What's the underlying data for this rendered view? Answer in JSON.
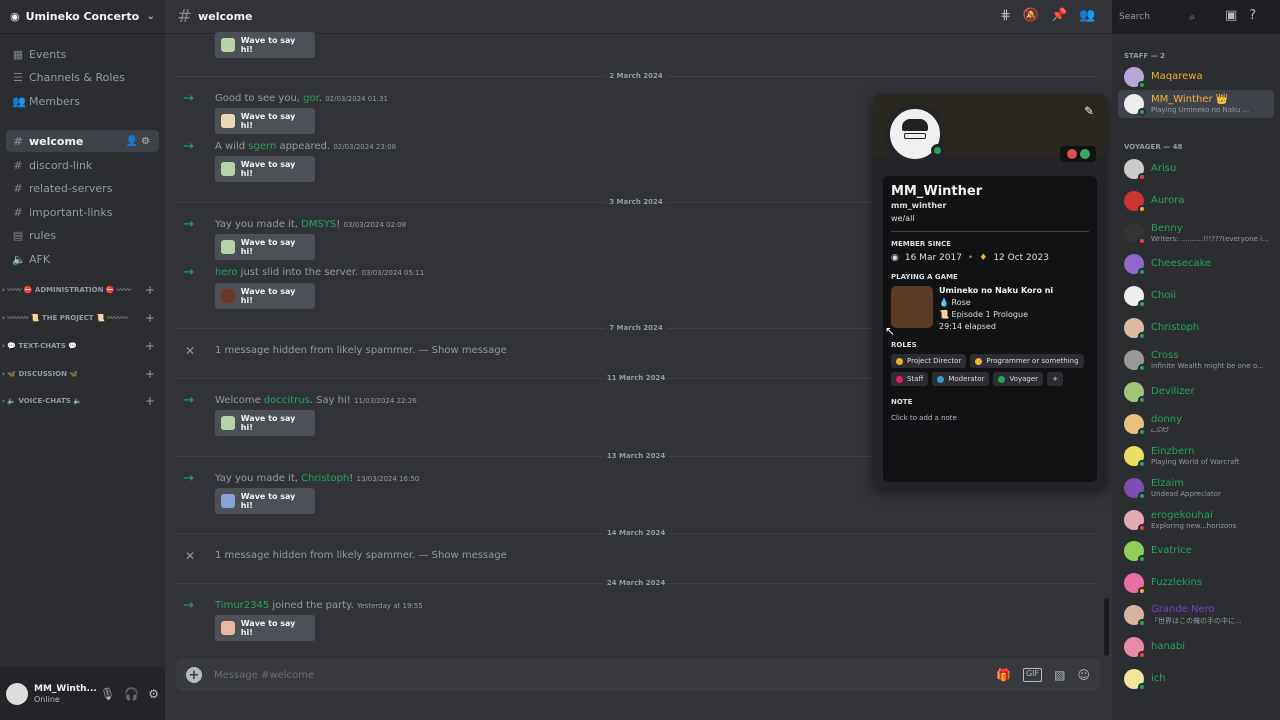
{
  "server": {
    "name": "Umineko Concerto"
  },
  "sidebar": {
    "top": [
      {
        "icon": "calendar-icon",
        "label": "Events"
      },
      {
        "icon": "list-icon",
        "label": "Channels & Roles"
      },
      {
        "icon": "members-icon",
        "label": "Members"
      }
    ],
    "channels": [
      {
        "label": "welcome",
        "icon": "#"
      },
      {
        "label": "discord-link",
        "icon": "#"
      },
      {
        "label": "related-servers",
        "icon": "#"
      },
      {
        "label": "important-links",
        "icon": "#"
      },
      {
        "label": "rules",
        "icon": "rules-icon"
      },
      {
        "label": "AFK",
        "icon": "speaker-icon"
      }
    ],
    "categories": [
      "〰〰 ⛔ ADMINISTRATION ⛔ 〰〰",
      "〰〰〰 📜 THE PROJECT 📜 〰〰〰",
      "💬 TEXT-CHATS 💬",
      "🦋 DISCUSSION 🦋",
      "🔈 VOICE-CHATS 🔈"
    ]
  },
  "user": {
    "name": "MM_Winth...",
    "status": "Online"
  },
  "channel": {
    "name": "welcome",
    "composer_placeholder": "Message #welcome"
  },
  "search": {
    "placeholder": "Search"
  },
  "messages": [
    {
      "kind": "wave",
      "wave": "Wave to say hi!"
    },
    {
      "kind": "date",
      "text": "2 March 2024"
    },
    {
      "kind": "join",
      "pre": "Good to see you, ",
      "who": "gor",
      "post": ".",
      "ts": "02/03/2024 01:31",
      "wave": "Wave to say hi!"
    },
    {
      "kind": "join",
      "pre": "A wild ",
      "who": "sgern",
      "post": " appeared.",
      "ts": "02/03/2024 23:08",
      "wave": "Wave to say hi!"
    },
    {
      "kind": "date",
      "text": "3 March 2024"
    },
    {
      "kind": "join",
      "pre": "Yay you made it, ",
      "who": "DMSYS",
      "post": "!",
      "ts": "03/03/2024 02:08",
      "wave": "Wave to say hi!"
    },
    {
      "kind": "join",
      "pre": "",
      "who": "hero",
      "post": " just slid into the server.",
      "ts": "03/03/2024 05:11",
      "wave": "Wave to say hi!"
    },
    {
      "kind": "date",
      "text": "7 March 2024"
    },
    {
      "kind": "hidden",
      "text": "1 message hidden from likely spammer. — ",
      "link": "Show message"
    },
    {
      "kind": "date",
      "text": "11 March 2024"
    },
    {
      "kind": "join",
      "pre": "Welcome ",
      "who": "doccitrus",
      "post": ". Say hi!",
      "ts": "11/03/2024 22:26",
      "wave": "Wave to say hi!"
    },
    {
      "kind": "date",
      "text": "13 March 2024"
    },
    {
      "kind": "join",
      "pre": "Yay you made it, ",
      "who": "Christoph",
      "post": "!",
      "ts": "13/03/2024 16:50",
      "wave": "Wave to say hi!"
    },
    {
      "kind": "date",
      "text": "14 March 2024"
    },
    {
      "kind": "hidden",
      "text": "1 message hidden from likely spammer. — ",
      "link": "Show message"
    },
    {
      "kind": "date",
      "text": "24 March 2024"
    },
    {
      "kind": "join",
      "pre": "",
      "who": "Timur2345",
      "post": " joined the party.",
      "ts": "Yesterday at 19:55",
      "wave": "Wave to say hi!"
    }
  ],
  "profile": {
    "name": "MM_Winther",
    "username": "mm_winther",
    "status": "we/all",
    "member_since_label": "MEMBER SINCE",
    "discord_date": "16 Mar 2017",
    "server_date": "12 Oct 2023",
    "game_label": "PLAYING A GAME",
    "game_title": "Umineko no Naku Koro ni",
    "game_char": "Rose",
    "game_episode": "Episode 1 Prologue",
    "game_elapsed": "29:14 elapsed",
    "roles_label": "ROLES",
    "roles": [
      {
        "name": "Project Director",
        "color": "#f0b232"
      },
      {
        "name": "Programmer or something",
        "color": "#f0b232"
      },
      {
        "name": "Staff",
        "color": "#e91e63"
      },
      {
        "name": "Moderator",
        "color": "#3498db"
      },
      {
        "name": "Voyager",
        "color": "#23a55a"
      }
    ],
    "roles_add": "+",
    "note_label": "NOTE",
    "note_placeholder": "Click to add a note"
  },
  "member_groups": [
    "STAFF — 2",
    "VOYAGER — 48"
  ],
  "members": [
    {
      "name": "Maqarewa",
      "activity": "",
      "color": "#f0b232"
    },
    {
      "name": "MM_Winther 👑",
      "activity": "Playing Umineko no Naku ...",
      "color": "#f0b232"
    },
    {
      "name": "Arisu",
      "activity": "",
      "color": "#23a55a"
    },
    {
      "name": "Aurora",
      "activity": "",
      "color": "#23a55a"
    },
    {
      "name": "Benny",
      "activity": "Writers: ..........!!!???(everyone i...",
      "color": "#23a55a"
    },
    {
      "name": "Cheesecake",
      "activity": "",
      "color": "#23a55a"
    },
    {
      "name": "Choii",
      "activity": "",
      "color": "#23a55a"
    },
    {
      "name": "Christoph",
      "activity": "",
      "color": "#23a55a"
    },
    {
      "name": "Cross",
      "activity": "Infinite Wealth might be one o...",
      "color": "#23a55a"
    },
    {
      "name": "Devilizer",
      "activity": "",
      "color": "#23a55a"
    },
    {
      "name": "donny",
      "activity": "ᓚᘏᗢ",
      "color": "#23a55a"
    },
    {
      "name": "Einzbern",
      "activity": "Playing World of Warcraft",
      "color": "#23a55a"
    },
    {
      "name": "Elzaim",
      "activity": "Undead Appreciator",
      "color": "#23a55a"
    },
    {
      "name": "erogekouhai",
      "activity": "Exploring new...horizons",
      "color": "#23a55a"
    },
    {
      "name": "Evatrice",
      "activity": "",
      "color": "#23a55a"
    },
    {
      "name": "Fuzzlekins",
      "activity": "",
      "color": "#23a55a"
    },
    {
      "name": "Grande Nero",
      "activity": "「世界はこの俺の手の中に...",
      "color": "#7b3fbf"
    },
    {
      "name": "hanabi",
      "activity": "",
      "color": "#23a55a"
    },
    {
      "name": "ich",
      "activity": "",
      "color": "#23a55a"
    }
  ]
}
